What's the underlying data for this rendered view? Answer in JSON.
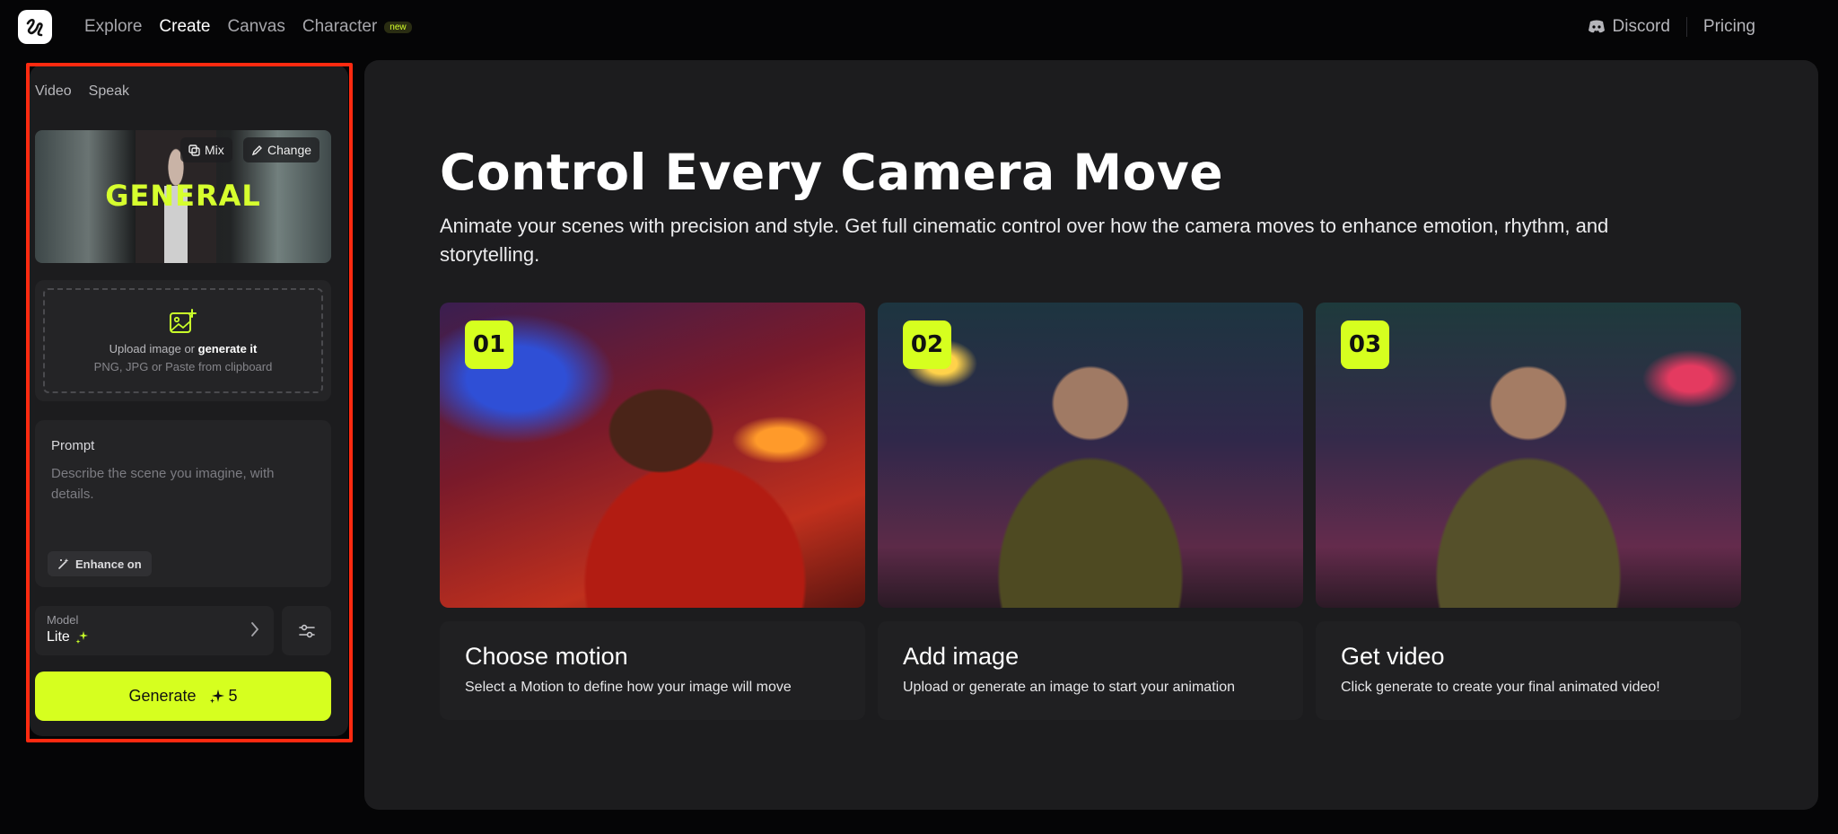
{
  "nav": {
    "items": [
      {
        "label": "Explore",
        "active": false
      },
      {
        "label": "Create",
        "active": true
      },
      {
        "label": "Canvas",
        "active": false
      },
      {
        "label": "Character",
        "active": false,
        "badge": "new"
      }
    ],
    "discord": "Discord",
    "pricing": "Pricing",
    "logo_icon": "squiggle-logo-icon"
  },
  "sidebar": {
    "modes": [
      "Video",
      "Speak"
    ],
    "preview": {
      "overlay_text": "GENERAL",
      "mix_label": "Mix",
      "change_label": "Change"
    },
    "upload": {
      "line1_prefix": "Upload image or ",
      "line1_link": "generate it",
      "line2": "PNG, JPG or Paste from clipboard"
    },
    "prompt": {
      "label": "Prompt",
      "placeholder": "Describe the scene you imagine, with details.",
      "enhance_label": "Enhance on"
    },
    "model": {
      "label": "Model",
      "value": "Lite"
    },
    "generate": {
      "label": "Generate",
      "credits": "5"
    },
    "highlight_color": "#ff2a10"
  },
  "main": {
    "title": "Control Every Camera Move",
    "description": "Animate your scenes with precision and style. Get full cinematic control over how the camera moves to enhance emotion, rhythm, and storytelling.",
    "steps": [
      {
        "num": "01",
        "title": "Choose motion",
        "desc": "Select a Motion to define how your image will move"
      },
      {
        "num": "02",
        "title": "Add image",
        "desc": "Upload or generate an image to start your animation"
      },
      {
        "num": "03",
        "title": "Get video",
        "desc": "Click generate to create your final animated video!"
      }
    ]
  },
  "colors": {
    "accent": "#d6ff1f",
    "background": "#050506",
    "panel": "#1c1c1e"
  }
}
